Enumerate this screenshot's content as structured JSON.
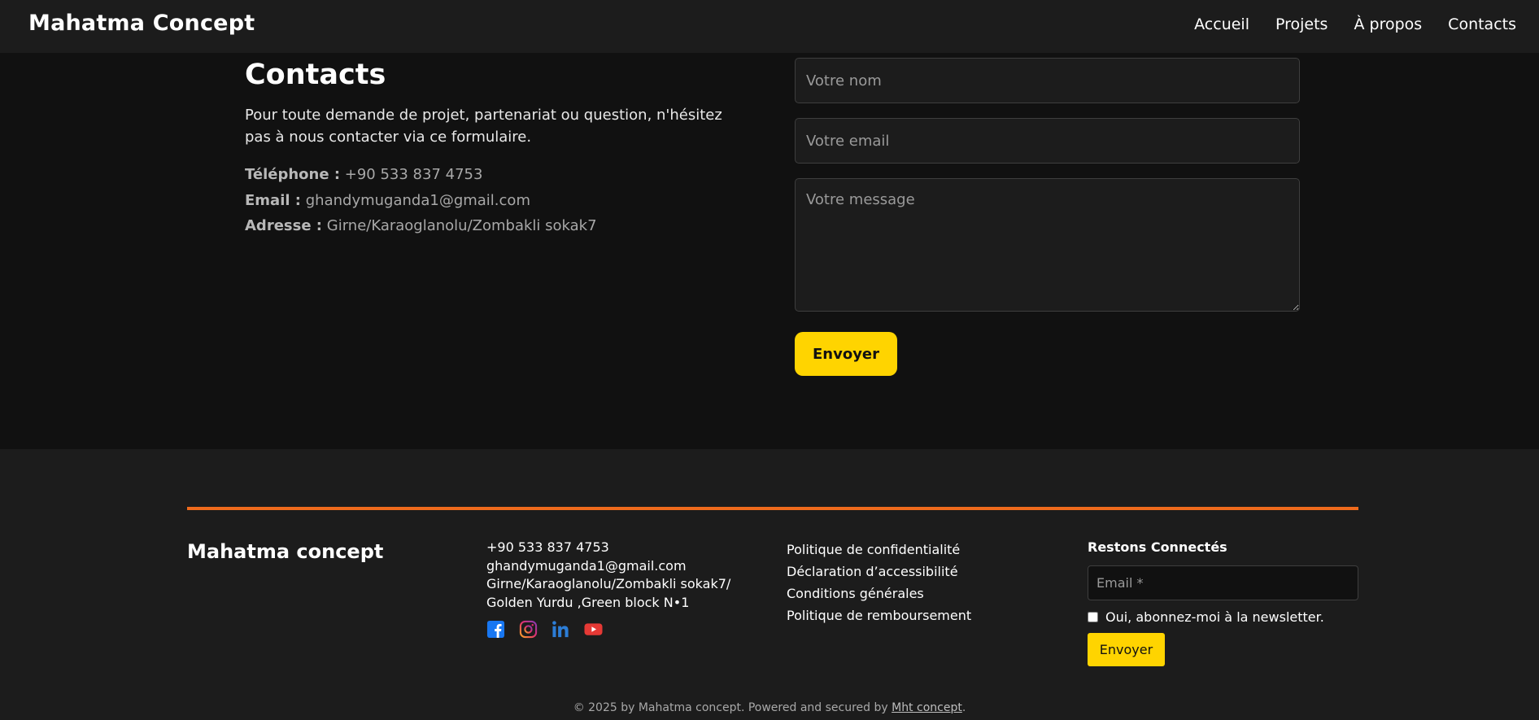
{
  "header": {
    "brand": "Mahatma Concept",
    "nav": [
      {
        "label": "Accueil"
      },
      {
        "label": "Projets"
      },
      {
        "label": "À propos"
      },
      {
        "label": "Contacts"
      }
    ]
  },
  "contact": {
    "title": "Contacts",
    "intro": "Pour toute demande de projet, partenariat ou question, n'hésitez pas à nous contacter via ce formulaire.",
    "phone_label": "Téléphone :",
    "phone_value": "+90 533 837 4753",
    "email_label": "Email :",
    "email_value": "ghandymuganda1@gmail.com",
    "address_label": "Adresse :",
    "address_value": "Girne/Karaoglanolu/Zombakli sokak7"
  },
  "form": {
    "name_placeholder": "Votre nom",
    "email_placeholder": "Votre email",
    "message_placeholder": "Votre message",
    "submit_label": "Envoyer"
  },
  "footer": {
    "brand": "Mahatma concept",
    "phone": "+90 533 837 4753",
    "email": "ghandymuganda1@gmail.com",
    "address_line1": "Girne/Karaoglanolu/Zombakli sokak7/",
    "address_line2": "Golden Yurdu ,Green block N•1",
    "socials": [
      {
        "icon": "facebook-icon"
      },
      {
        "icon": "instagram-icon"
      },
      {
        "icon": "linkedin-icon"
      },
      {
        "icon": "youtube-icon"
      }
    ],
    "links": [
      {
        "label": "Politique de confidentialité"
      },
      {
        "label": "Déclaration d’accessibilité"
      },
      {
        "label": "Conditions générales"
      },
      {
        "label": "Politique de remboursement"
      }
    ],
    "newsletter": {
      "title": "Restons Connectés",
      "email_placeholder": "Email *",
      "checkbox_label": "Oui, abonnez-moi à la newsletter.",
      "submit_label": "Envoyer"
    },
    "copyright_prefix": "© 2025 by Mahatma concept. Powered and secured by ",
    "copyright_link": "Mht concept",
    "copyright_suffix": "."
  },
  "colors": {
    "accent_yellow": "#ffd400",
    "accent_orange": "#ee6a1c",
    "background": "#111111",
    "surface": "#1c1c1c"
  }
}
